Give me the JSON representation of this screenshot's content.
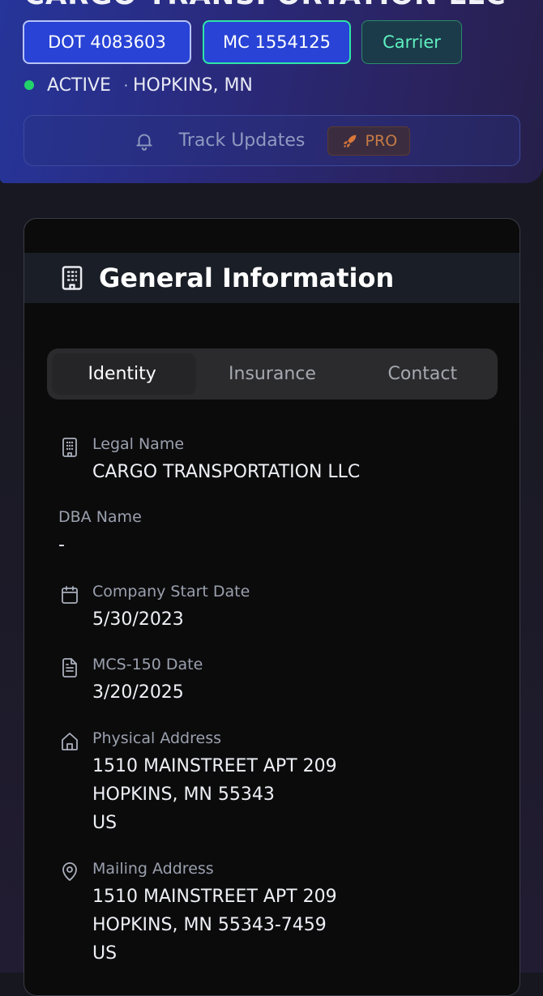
{
  "header": {
    "company_name": "CARGO TRANSPORTATION LLC",
    "chips": {
      "dot": "DOT 4083603",
      "mc": "MC 1554125",
      "type": "Carrier"
    },
    "status": "ACTIVE",
    "location": "HOPKINS, MN",
    "track_updates_label": "Track Updates",
    "pro_badge": "PRO",
    "colors": {
      "header_gradient_start": "#26359a",
      "active_dot": "#22d36b",
      "mc_border": "#2ee6a6",
      "pro": "#c77a45"
    }
  },
  "card": {
    "title": "General Information",
    "tabs": [
      {
        "label": "Identity",
        "active": true
      },
      {
        "label": "Insurance",
        "active": false
      },
      {
        "label": "Contact",
        "active": false
      }
    ],
    "fields": {
      "legal_name": {
        "label": "Legal Name",
        "value": "CARGO TRANSPORTATION LLC",
        "icon": "building-icon"
      },
      "dba_name": {
        "label": "DBA Name",
        "value": "-"
      },
      "start_date": {
        "label": "Company Start Date",
        "value": "5/30/2023",
        "icon": "calendar-icon"
      },
      "mcs150_date": {
        "label": "MCS-150 Date",
        "value": "3/20/2025",
        "icon": "document-icon"
      },
      "physical_address": {
        "label": "Physical Address",
        "line1": "1510 MAINSTREET APT 209",
        "line2": "HOPKINS, MN 55343",
        "line3": "US",
        "icon": "home-icon"
      },
      "mailing_address": {
        "label": "Mailing Address",
        "line1": "1510 MAINSTREET APT 209",
        "line2": "HOPKINS, MN 55343-7459",
        "line3": "US",
        "icon": "map-pin-icon"
      }
    }
  }
}
